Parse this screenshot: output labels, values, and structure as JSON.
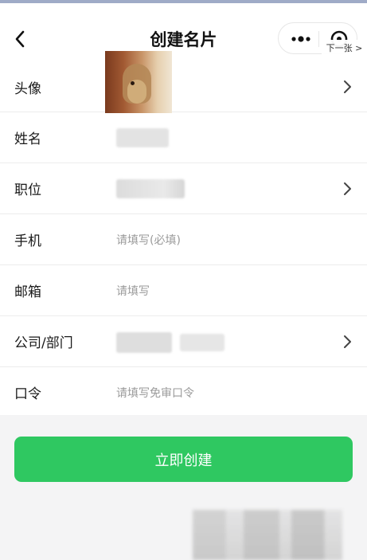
{
  "navbar": {
    "title": "创建名片",
    "next_label": "下一张 >"
  },
  "form": {
    "rows": [
      {
        "label": "头像",
        "value": "",
        "has_arrow": true
      },
      {
        "label": "姓名",
        "value": "",
        "has_arrow": false
      },
      {
        "label": "职位",
        "value": "",
        "has_arrow": true
      },
      {
        "label": "手机",
        "value": "",
        "placeholder": "请填写(必填)",
        "has_arrow": false
      },
      {
        "label": "邮箱",
        "value": "",
        "placeholder": "请填写",
        "has_arrow": false
      },
      {
        "label": "公司/部门",
        "value": "",
        "has_arrow": true
      },
      {
        "label": "口令",
        "value": "",
        "placeholder": "请填写免审口令",
        "has_arrow": false
      }
    ]
  },
  "actions": {
    "create_label": "立即创建"
  },
  "colors": {
    "primary": "#2fc861",
    "background": "#f4f4f5",
    "divider": "#ececec"
  },
  "icons": [
    "back-arrow-icon",
    "more-dots-icon",
    "close-circle-icon",
    "chevron-right-icon"
  ]
}
